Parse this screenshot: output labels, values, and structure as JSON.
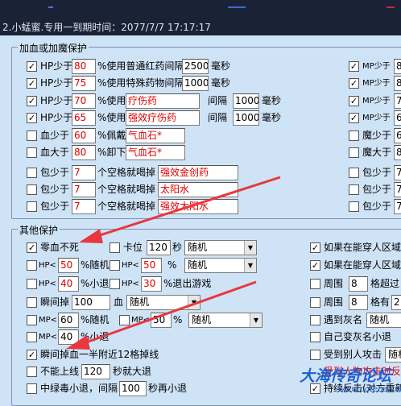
{
  "window": {
    "title": "2.小蜢蜜.专用一到期时间：2077/7/7 17:17:17"
  },
  "colors": {
    "background": "#cfe3f7",
    "titlebar": "#1a2236",
    "accent_red": "#e00000",
    "arrow": "#e8383d",
    "watermark": "#1e5fd0"
  },
  "hp_group": {
    "title": "加血或加魔保护",
    "rows": [
      {
        "checked": true,
        "label": "HP少于",
        "value": "80",
        "action": "%使用普通红药间隔",
        "interval": "2500",
        "unit": "毫秒"
      },
      {
        "checked": true,
        "label": "HP少于",
        "value": "75",
        "action": "%使用特殊药物间隔",
        "interval": "1000",
        "unit": "毫秒"
      },
      {
        "checked": true,
        "label": "HP少于",
        "value": "70",
        "action": "%使用",
        "item": "疗伤药",
        "interval_label": "间隔",
        "interval": "1000",
        "unit": "毫秒"
      },
      {
        "checked": true,
        "label": "HP少于",
        "value": "65",
        "action": "%使用",
        "item": "强效疗伤药",
        "interval_label": "间隔",
        "interval": "1000",
        "unit": "毫秒"
      },
      {
        "checked": false,
        "label": "血少于",
        "value": "60",
        "action": "%佩戴",
        "item": "气血石*"
      },
      {
        "checked": false,
        "label": "血大于",
        "value": "80",
        "action": "%卸下",
        "item": "气血石*"
      },
      {
        "checked": false,
        "label": "包少于",
        "value": "7",
        "action": "个空格就喝掉",
        "item": "强效金创药"
      },
      {
        "checked": false,
        "label": "包少于",
        "value": "7",
        "action": "个空格就喝掉",
        "item": "太阳水"
      },
      {
        "checked": false,
        "label": "包少于",
        "value": "7",
        "action": "个空格就喝掉",
        "item": "强效太阳水"
      }
    ],
    "right_column": [
      {
        "checked": true,
        "label": "MP少于",
        "value": "8"
      },
      {
        "checked": true,
        "label": "MP少于",
        "value": "8"
      },
      {
        "checked": true,
        "label": "MP少于",
        "value": "7"
      },
      {
        "checked": true,
        "label": "MP少于",
        "value": "6"
      },
      {
        "checked": false,
        "label": "魔少于",
        "value": "6"
      },
      {
        "checked": false,
        "label": "魔大于",
        "value": "8"
      },
      {
        "checked": false,
        "label": "包少于",
        "value": "7"
      },
      {
        "checked": false,
        "label": "包少于",
        "value": "7"
      },
      {
        "checked": false,
        "label": "包少于",
        "value": "7"
      }
    ]
  },
  "other_group": {
    "title": "其他保护",
    "no_die": {
      "checked": true,
      "label": "零血不死"
    },
    "stuck": {
      "checked": false,
      "label": "卡位",
      "value": "120",
      "unit": "秒",
      "option": "随机"
    },
    "hp_random": {
      "checked": false,
      "label": "HP<",
      "value": "50",
      "suffix": "%随机"
    },
    "hp_pct": {
      "checked": false,
      "label": "HP<",
      "value": "50",
      "suffix": "%",
      "option": "随机"
    },
    "hp_small_retreat": {
      "checked": false,
      "label": "HP<",
      "value": "40",
      "suffix": "%小退"
    },
    "hp_exit": {
      "checked": false,
      "label": "HP<",
      "value": "30",
      "suffix": "%退出游戏"
    },
    "instant_drop": {
      "checked": false,
      "label": "瞬间掉",
      "value": "100",
      "unit": "血",
      "option": "随机"
    },
    "mp_random": {
      "checked": false,
      "label": "MP<",
      "value": "60",
      "suffix": "%随机"
    },
    "mp_pct": {
      "checked": false,
      "label": "MP<",
      "value": "50",
      "suffix": "%",
      "option": "随机"
    },
    "mp_small_retreat": {
      "checked": false,
      "label": "MP<",
      "value": "40",
      "suffix": "%小退"
    },
    "instant_half": {
      "checked": true,
      "label": "瞬间掉血一半附近12格掉线"
    },
    "cannot_login": {
      "checked": false,
      "label": "不能上线",
      "value": "120",
      "suffix": "秒就大退"
    },
    "poison": {
      "checked": false,
      "label": "中绿毒小退，间隔",
      "value": "100",
      "suffix": "秒再小退"
    },
    "right": [
      {
        "checked": true,
        "label": "如果在能穿人区域"
      },
      {
        "checked": true,
        "label": "如果在能穿人区域"
      },
      {
        "checked": false,
        "label": "周围",
        "value": "8",
        "suffix": "格超过"
      },
      {
        "checked": false,
        "label": "周围",
        "value": "8",
        "suffix": "格有",
        "extra": "2"
      },
      {
        "checked": false,
        "label": "遇到灰名",
        "option": "随机"
      },
      {
        "checked": false,
        "label": "自己变灰名小退"
      },
      {
        "checked": false,
        "label": "受到别人攻击",
        "option": "随机"
      },
      {
        "label": "受到人物攻击时反"
      },
      {
        "checked": true,
        "label": "持续反击(对方重新"
      }
    ]
  },
  "watermark": {
    "text": "大海传奇论坛",
    "url": "www.cqteba.com"
  }
}
